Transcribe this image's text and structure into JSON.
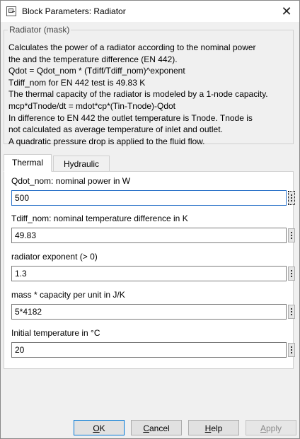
{
  "window": {
    "title": "Block Parameters: Radiator",
    "close_glyph": "✕"
  },
  "mask": {
    "legend": "Radiator (mask)",
    "description": [
      "Calculates the power of a radiator according to the nominal power",
      "the and the temperature difference (EN 442).",
      "Qdot = Qdot_nom * (Tdiff/Tdiff_nom)^exponent",
      "Tdiff_nom for EN 442 test is 49.83 K",
      "The thermal capacity of the radiator is modeled by a 1-node capacity.",
      "mcp*dTnode/dt = mdot*cp*(Tin-Tnode)-Qdot",
      "In difference to EN 442 the outlet temperature is Tnode. Tnode is",
      "not calculated as average temperature of inlet and outlet.",
      "A quadratic pressure drop is applied to the fluid flow."
    ]
  },
  "tabs": [
    {
      "label": "Thermal",
      "active": true
    },
    {
      "label": "Hydraulic",
      "active": false
    }
  ],
  "params": [
    {
      "label": "Qdot_nom: nominal power in W",
      "value": "500"
    },
    {
      "label": "Tdiff_nom: nominal temperature difference in K",
      "value": "49.83"
    },
    {
      "label": "radiator exponent (> 0)",
      "value": "1.3"
    },
    {
      "label": "mass * capacity per unit in J/K",
      "value": "5*4182"
    },
    {
      "label": "Initial temperature in °C",
      "value": "20"
    }
  ],
  "buttons": {
    "ok": {
      "first": "O",
      "rest": "K"
    },
    "cancel": {
      "first": "C",
      "rest": "ancel"
    },
    "help": {
      "first": "H",
      "rest": "elp"
    },
    "apply": {
      "first": "A",
      "rest": "pply"
    }
  }
}
